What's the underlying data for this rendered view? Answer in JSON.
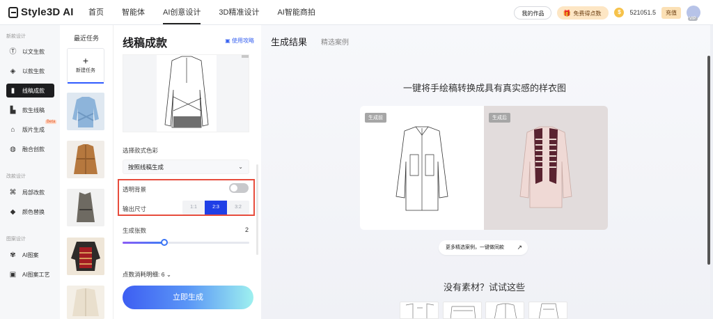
{
  "header": {
    "logo": "Style3D AI",
    "nav": [
      "首页",
      "智能体",
      "AI创意设计",
      "3D精准设计",
      "AI智能商拍"
    ],
    "active_nav_index": 2,
    "my_works": "我的作品",
    "free_points": "免费得点数",
    "points": "521051.5",
    "recharge": "充值",
    "vip": "VIP"
  },
  "sidebar": {
    "section1": "新款设计",
    "section2": "改款设计",
    "section3": "图案设计",
    "items": [
      {
        "label": "以文生款",
        "icon": "text-to-design-icon"
      },
      {
        "label": "以款生款",
        "icon": "design-to-design-icon"
      },
      {
        "label": "线稿成款",
        "icon": "sketch-to-design-icon"
      },
      {
        "label": "款生线稿",
        "icon": "design-to-sketch-icon"
      },
      {
        "label": "版片生成",
        "icon": "pattern-piece-icon"
      },
      {
        "label": "融合创款",
        "icon": "fusion-icon"
      },
      {
        "label": "局部改款",
        "icon": "partial-edit-icon"
      },
      {
        "label": "颜色替换",
        "icon": "color-replace-icon"
      },
      {
        "label": "AI图案",
        "icon": "ai-pattern-icon"
      },
      {
        "label": "AI图案工艺",
        "icon": "ai-pattern-craft-icon"
      }
    ],
    "beta_badge": "Beta"
  },
  "tasks": {
    "title": "最近任务",
    "new_task_plus": "+",
    "new_task": "新建任务"
  },
  "panel": {
    "title": "线稿成款",
    "guide_link": "使用攻略",
    "color_label": "选择款式色彩",
    "color_value": "按照线稿生成",
    "transparent_bg": "透明背景",
    "transparent_bg_on": false,
    "output_size": "输出尺寸",
    "size_options": [
      "1:1",
      "2:3",
      "3:2"
    ],
    "selected_size_index": 1,
    "gen_count_label": "生成张数",
    "gen_count": "2",
    "slider_fraction": 0.33,
    "cost_detail": "点数消耗明细: 6",
    "generate": "立即生成"
  },
  "main": {
    "tab_results": "生成结果",
    "tab_examples": "精选案例",
    "headline": "一键将手绘稿转换成具有真实感的样衣图",
    "before_tag": "生成前",
    "after_tag": "生成后",
    "more_cases": "更多精选案例，一键做同款",
    "no_material": "没有素材？试试这些"
  },
  "colors": {
    "accent_blue": "#1f3fe6",
    "highlight_red": "#e74c3c",
    "active_nav_bg": "#1d1d1f"
  }
}
